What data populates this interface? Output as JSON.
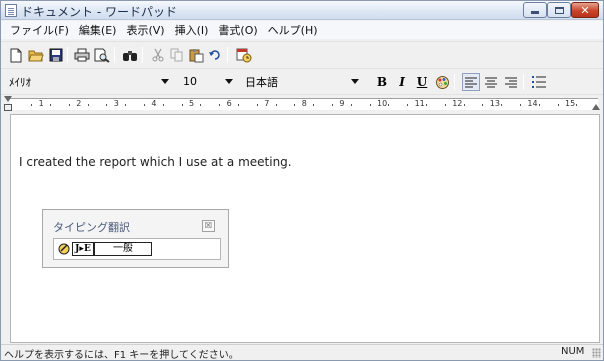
{
  "window": {
    "title": "ドキュメント - ワードパッド"
  },
  "menu": {
    "items": [
      "ファイル(F)",
      "編集(E)",
      "表示(V)",
      "挿入(I)",
      "書式(O)",
      "ヘルプ(H)"
    ]
  },
  "toolbar": {
    "icons": [
      "new-icon",
      "open-icon",
      "save-icon",
      "print-icon",
      "print-preview-icon",
      "find-icon",
      "cut-icon",
      "copy-icon",
      "paste-icon",
      "undo-icon",
      "insert-datetime-icon"
    ]
  },
  "format": {
    "font": "ﾒｲﾘｵ",
    "size": "10",
    "script": "日本語",
    "bold": "B",
    "italic": "I",
    "underline": "U",
    "align_left_active": true
  },
  "ruler": {
    "numbers": [
      "1",
      "2",
      "3",
      "4",
      "5",
      "6",
      "7",
      "8",
      "9",
      "10",
      "11",
      "12",
      "13",
      "14",
      "15"
    ]
  },
  "document": {
    "text": "I created the report which I use at a meeting."
  },
  "ime_panel": {
    "title": "タイピング翻訳",
    "close": "☒",
    "direction": "J▸E",
    "mode": "一般"
  },
  "status": {
    "help": "ヘルプを表示するには、F1 キーを押してください。",
    "num": "NUM"
  },
  "colors": {
    "close_button": "#c8452b",
    "title_text": "#1e2e4a"
  }
}
